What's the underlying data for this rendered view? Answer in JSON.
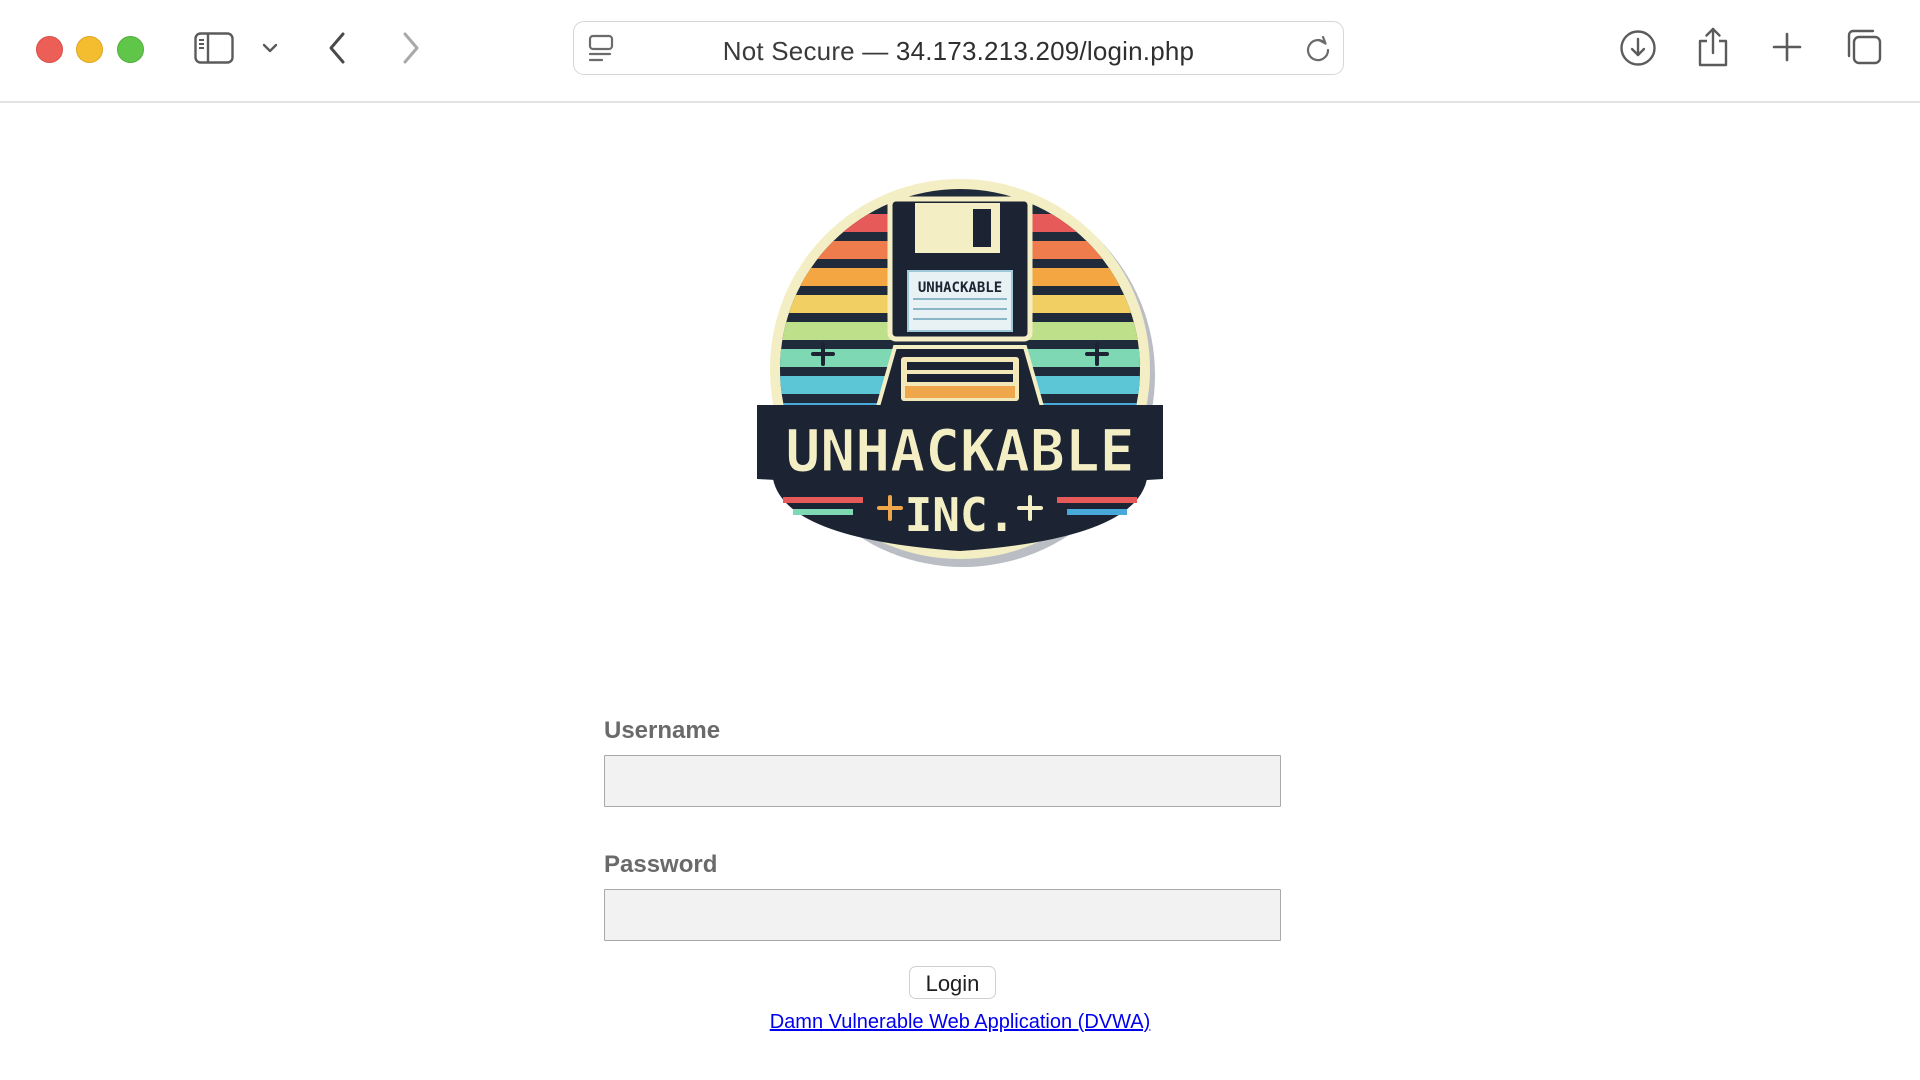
{
  "browser": {
    "address_bar": {
      "security_label": "Not Secure —",
      "url": "34.173.213.209/login.php"
    },
    "icons": {
      "sidebar": "sidebar-icon",
      "chevron": "chevron-down-icon",
      "back": "back-arrow-icon",
      "forward": "forward-arrow-icon",
      "reader": "reader-icon",
      "reload": "reload-icon",
      "download": "download-icon",
      "share": "share-icon",
      "new_tab": "plus-icon",
      "tabs": "tab-overview-icon"
    }
  },
  "logo": {
    "title_line1": "UNHACKABLE",
    "title_line2": "INC.",
    "disk_label": "UNHACKABLE"
  },
  "login_form": {
    "username_label": "Username",
    "password_label": "Password",
    "username_value": "",
    "password_value": "",
    "submit_label": "Login"
  },
  "footer": {
    "link_text": "Damn Vulnerable Web Application (DVWA)"
  },
  "colors": {
    "link": "#0000ee",
    "close": "#ec5f57",
    "minimize": "#f4bd2f",
    "maximize": "#60c64a"
  }
}
